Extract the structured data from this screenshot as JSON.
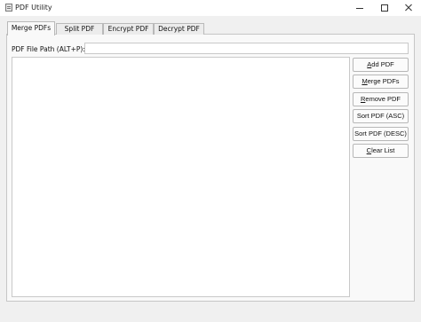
{
  "window": {
    "title": "PDF Utility"
  },
  "tabs": [
    {
      "label": "Merge PDFs",
      "active": true
    },
    {
      "label": "Split PDF",
      "active": false
    },
    {
      "label": "Encrypt PDF",
      "active": false
    },
    {
      "label": "Decrypt PDF",
      "active": false
    }
  ],
  "merge": {
    "path_label": "PDF File Path (ALT+P):",
    "path_value": "",
    "files": [],
    "buttons": [
      {
        "mnemonic": "A",
        "rest": "dd PDF"
      },
      {
        "mnemonic": "M",
        "rest": "erge PDFs"
      },
      {
        "mnemonic": "R",
        "rest": "emove PDF"
      },
      {
        "mnemonic": "",
        "rest": "Sort PDF (ASC)"
      },
      {
        "mnemonic": "",
        "rest": "Sort PDF (DESC)"
      },
      {
        "mnemonic": "C",
        "rest": "lear List"
      }
    ]
  },
  "icons": {
    "app": "pdf-app-icon",
    "minimize": "minimize-icon",
    "maximize": "maximize-icon",
    "close": "close-icon"
  }
}
